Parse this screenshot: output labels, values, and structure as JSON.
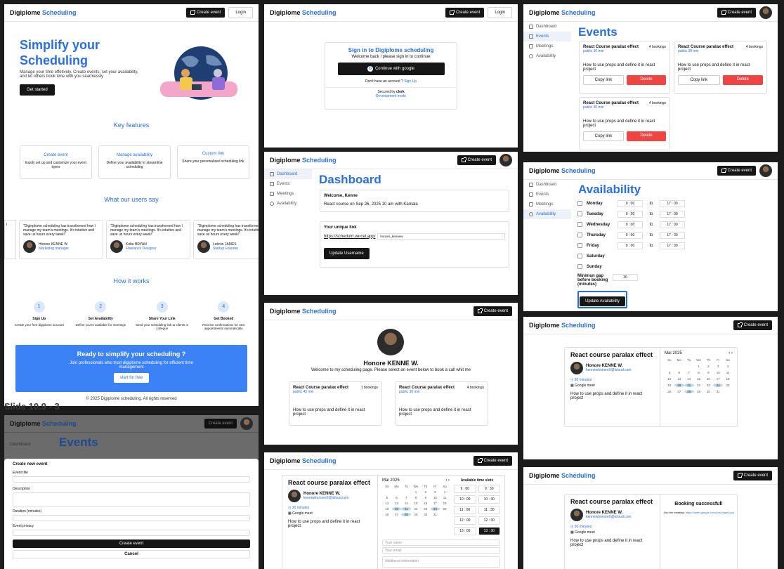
{
  "brand": {
    "name": "Digiplome",
    "accent": "Scheduling"
  },
  "nav": {
    "create_event": "Create event",
    "login": "Login"
  },
  "sidebar": {
    "dashboard": "Dashboard",
    "events": "Events",
    "meetings": "Meetings",
    "availability": "Availability"
  },
  "landing": {
    "hero_title": "Simplify your Scheduling",
    "hero_sub": "Manage your time effetively. Create events, set your availability, and let others book time with you seamlessly",
    "get_started": "Get started",
    "key_features": "Key features",
    "features": [
      {
        "title": "Create event",
        "desc": "Easily set up and customize your event types"
      },
      {
        "title": "Manage availability",
        "desc": "Define your availability to streamline scheduling"
      },
      {
        "title": "Custom link",
        "desc": "Share your personalized scheduling link"
      }
    ],
    "users_say": "What our users say",
    "testimonial_partial": "\"Diginplome scheduling has transformed how I manage my team's meetings. It's intuitive",
    "testimonial_text": "\"Diginplome scheduling has transformed how I manage my team's meetings. It's intuitive and save us hours every week!\"",
    "testimonials": [
      {
        "name": "Honore KENNE W",
        "role": "Marketing manager"
      },
      {
        "name": "Kobe BRYAN",
        "role": "Freelance Designer"
      },
      {
        "name": "Lebron JAMES",
        "role": "Startup Founder"
      }
    ],
    "how_it_works": "How it works",
    "steps": [
      {
        "n": "1",
        "title": "Sign Up",
        "desc": "Create your free digiplome account"
      },
      {
        "n": "2",
        "title": "Set Availability",
        "desc": "Define you're available for meetings"
      },
      {
        "n": "3",
        "title": "Share Your Link",
        "desc": "Send your scheduling link to clients or collegue"
      },
      {
        "n": "4",
        "title": "Get Booked",
        "desc": "Receive confirmations for new appointments automatically"
      }
    ],
    "cta_title": "Ready to simplify your scheduling ?",
    "cta_sub": "Join professionals who trust digiplome scheduling for efficient time management",
    "cta_button": "start for free",
    "footer": "© 2025 Digiplome scheduling. All rights reserved"
  },
  "signin": {
    "title": "Sign in to Digiplome scheduling",
    "sub": "Welcome back ! please sign in to continue",
    "google": "Continue with google",
    "no_account": "Don't have an account ?",
    "signup": "Sign Up",
    "secured": "Secured by",
    "clerk": "clerk",
    "dev": "Development mode"
  },
  "events": {
    "title": "Events",
    "cards": [
      {
        "title": "React Course paralax effect",
        "meta": "public 30 min",
        "count": "4 bookings",
        "desc": "How to use props and define it in react project"
      },
      {
        "title": "React Course paralax effect",
        "meta": "public 30 min",
        "count": "4 bookings",
        "desc": "How to use props and define it in react project"
      },
      {
        "title": "React Course paralax effect",
        "meta": "public 30 min",
        "count": "4 bookings",
        "desc": "How to use props and define it in react project"
      }
    ],
    "copy": "Copy link",
    "delete": "Delete"
  },
  "dashboard": {
    "title": "Dashboard",
    "welcome": "Welcome, Kenne",
    "upcoming": "React course on Sep 26, 2025 10 am with Kamala",
    "link_title": "Your unique link",
    "link_prefix": "https://schedulrr.vercel.app/",
    "username": "honore_kennew",
    "update": "Update Username"
  },
  "availability": {
    "title": "Availability",
    "days": [
      {
        "day": "Monday",
        "from": "9 : 00",
        "to": "17 : 00"
      },
      {
        "day": "Tuesday",
        "from": "9 : 00",
        "to": "17 : 00"
      },
      {
        "day": "Wednesday",
        "from": "9 : 00",
        "to": "17 : 00"
      },
      {
        "day": "Thursday",
        "from": "9 : 00",
        "to": "17 : 00"
      },
      {
        "day": "Friday",
        "from": "9 : 00",
        "to": "17 : 00"
      },
      {
        "day": "Saturday",
        "from": "",
        "to": ""
      },
      {
        "day": "Sunday",
        "from": "",
        "to": ""
      }
    ],
    "to_label": "to",
    "gap_label": "Minimun gap before booking (minutes)",
    "gap_value": "30",
    "update": "Update Availability"
  },
  "profile": {
    "name": "Honore KENNE W.",
    "welcome": "Welcome to my scheduling page. Please select an event below to book a call whit me",
    "cards": [
      {
        "title": "React Course paralax effect",
        "meta": "public 45 min",
        "count": "1 bookings",
        "desc": "How to use props and define it in react project"
      },
      {
        "title": "React Course paralax effect",
        "meta": "public 30 min",
        "count": "4 bookings",
        "desc": "How to use props and define it in react project"
      }
    ]
  },
  "booking": {
    "title": "React course paralax effect",
    "host": "Honore KENNE W.",
    "email": "kennewhonore0@icloud.com",
    "duration": "30 minutes",
    "location": "Google meet",
    "desc": "How to use props and define it in react project",
    "month": "Mai 2025",
    "weekdays": [
      "Su",
      "Mo",
      "Tu",
      "We",
      "Th",
      "Fr",
      "Sa"
    ],
    "days": [
      "",
      "",
      "",
      "1",
      "2",
      "3",
      "4",
      "5",
      "6",
      "7",
      "8",
      "9",
      "10",
      "11",
      "12",
      "13",
      "14",
      "15",
      "16",
      "17",
      "18",
      "19",
      "20",
      "21",
      "22",
      "23",
      "24",
      "25",
      "26",
      "27",
      "28",
      "29",
      "30",
      "31"
    ],
    "highlight": [
      "20",
      "21",
      "24",
      "28"
    ],
    "slots_title": "Available time slots",
    "slots": [
      "9 : 00",
      "9 : 30",
      "10 : 00",
      "10 : 30",
      "11 : 00",
      "11 : 30",
      "12 : 00",
      "12 : 30",
      "13 : 00",
      "13 : 30"
    ],
    "selected_slot": "13 : 30",
    "name_ph": "Your name",
    "email_ph": "Your email",
    "info_ph": "Additional information",
    "success": "Booking successful!",
    "join": "Join the meeting:",
    "join_link": "https://meet.google.com/pxn-bwgr-hrsy"
  },
  "modal": {
    "title": "Create new event",
    "event_title": "Event title",
    "description": "Description",
    "duration": "Duration (minutes)",
    "privacy": "Event privacy",
    "create": "Create event",
    "cancel": "Cancel"
  },
  "slide_labels": [
    "Slide 10.9 - 3"
  ],
  "colors": {
    "accent": "#2a6fdb",
    "danger": "#ef4444",
    "dark": "#161616",
    "cta": "#3b82f6"
  }
}
